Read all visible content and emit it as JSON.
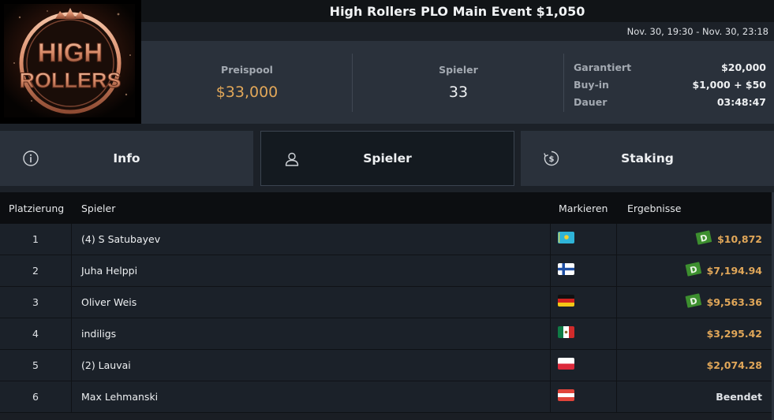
{
  "header": {
    "logo_text": [
      "HIGH",
      "ROLLERS"
    ],
    "title": "High Rollers PLO Main Event $1,050",
    "dates": "Nov. 30, 19:30 - Nov. 30, 23:18"
  },
  "summary": {
    "prize_pool_label": "Preispool",
    "prize_pool_value": "$33,000",
    "players_label": "Spieler",
    "players_value": "33",
    "details": [
      {
        "key": "Garantiert",
        "value": "$20,000"
      },
      {
        "key": "Buy-in",
        "value": "$1,000 + $50"
      },
      {
        "key": "Dauer",
        "value": "03:48:47"
      }
    ]
  },
  "tabs": [
    {
      "label": "Info",
      "icon": "info-icon"
    },
    {
      "label": "Spieler",
      "icon": "user-icon",
      "active": true
    },
    {
      "label": "Staking",
      "icon": "dollar-cycle-icon"
    }
  ],
  "table": {
    "headers": {
      "place": "Platzierung",
      "player": "Spieler",
      "mark": "Markieren",
      "results": "Ergebnisse"
    },
    "rows": [
      {
        "place": "1",
        "player": "(4) S Satubayev",
        "flag": "kazakhstan-flag",
        "badge": true,
        "result": "$10,872"
      },
      {
        "place": "2",
        "player": "Juha Helppi",
        "flag": "finland-flag",
        "badge": true,
        "result": "$7,194.94"
      },
      {
        "place": "3",
        "player": "Oliver Weis",
        "flag": "germany-flag",
        "badge": true,
        "result": "$9,563.36"
      },
      {
        "place": "4",
        "player": "indiligs",
        "flag": "mexico-flag",
        "badge": false,
        "result": "$3,295.42"
      },
      {
        "place": "5",
        "player": "(2) Lauvai",
        "flag": "poland-flag",
        "badge": false,
        "result": "$2,074.28"
      },
      {
        "place": "6",
        "player": "Max Lehmanski",
        "flag": "austria-flag",
        "badge": false,
        "result": "Beendet"
      }
    ]
  },
  "colors": {
    "accent_gold": "#e1a759",
    "badge_green": "#3d8f2f",
    "panel": "#2a313b"
  },
  "badge_letter": "D"
}
